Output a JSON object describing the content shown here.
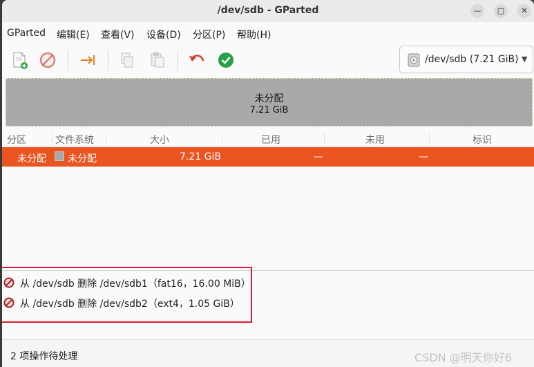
{
  "window": {
    "title": "/dev/sdb - GParted"
  },
  "menu": [
    "GParted",
    "编辑(E)",
    "查看(V)",
    "设备(D)",
    "分区(P)",
    "帮助(H)"
  ],
  "toolbar": {
    "device": "/dev/sdb (7.21 GiB)"
  },
  "partition_graph": {
    "label": "未分配",
    "size": "7.21 GiB"
  },
  "table": {
    "headers": [
      "分区",
      "文件系统",
      "大小",
      "已用",
      "未用",
      "标识"
    ],
    "rows": [
      {
        "partition": "未分配",
        "filesystem": "未分配",
        "size": "7.21 GiB",
        "used": "—",
        "unused": "—",
        "flags": ""
      }
    ]
  },
  "operations": [
    "从 /dev/sdb 删除 /dev/sdb1（fat16，16.00 MiB）",
    "从 /dev/sdb 删除 /dev/sdb2（ext4，1.05 GiB）"
  ],
  "status": "2 项操作待处理",
  "watermark": "CSDN @明天你好6",
  "colors": {
    "selected_row": "#e95420",
    "unallocated": "#a9a9a9",
    "highlight": "#e0182d"
  }
}
